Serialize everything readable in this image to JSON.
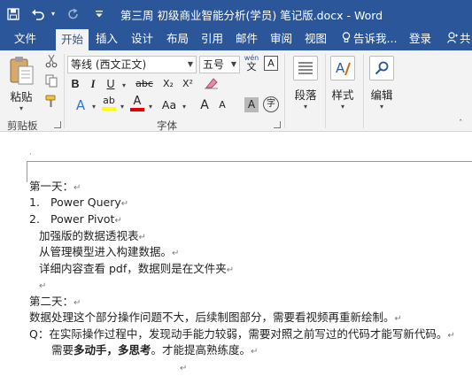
{
  "window": {
    "title": "第三周 初级商业智能分析(学员) 笔记版.docx - Word"
  },
  "quick_access": {
    "save_icon": "save-icon",
    "undo_icon": "undo-icon",
    "redo_icon": "redo-icon",
    "customize_icon": "customize-icon"
  },
  "tabs": {
    "file": "文件",
    "home": "开始",
    "insert": "插入",
    "design": "设计",
    "layout": "布局",
    "references": "引用",
    "mailings": "邮件",
    "review": "审阅",
    "view": "视图",
    "tell_me": "告诉我...",
    "login": "登录",
    "share": "共"
  },
  "ribbon": {
    "clipboard": {
      "paste_label": "粘贴",
      "group_label": "剪贴板"
    },
    "font": {
      "font_name": "等线 (西文正文)",
      "font_size": "五号",
      "wen_glyph": "wén",
      "wen_char": "文",
      "boxed_a": "A",
      "bold": "B",
      "italic": "I",
      "underline": "U",
      "strike": "abc",
      "subscript": "X₂",
      "superscript": "X²",
      "highlight": "ab",
      "font_color": "A",
      "change_case": "Aa",
      "grow": "A",
      "shrink": "A",
      "shading": "A",
      "enclose": "字",
      "group_label": "字体"
    },
    "paragraph": {
      "label": "段落"
    },
    "styles": {
      "label": "样式"
    },
    "editing": {
      "label": "编辑"
    }
  },
  "document": {
    "header_mark": "·",
    "lines": {
      "day1": "第一天：",
      "item1_num": "1.",
      "item1": "Power Query",
      "item2_num": "2.",
      "item2": "Power Pivot",
      "line_a": "加强版的数据透视表",
      "line_b": "从管理模型进入构建数据。",
      "line_c": "详细内容查看 pdf，数据则是在文件夹",
      "day2": "第二天：",
      "line_d": "数据处理这个部分操作问题不大，后续制图部分，需要看视频再重新绘制。",
      "line_e": "Q：在实际操作过程中，发现动手能力较弱，需要对照之前写过的代码才能写新代码。",
      "line_f_prefix": "需要",
      "line_f_bold": "多动手，多思考",
      "line_f_suffix": "。才能提高熟练度。"
    },
    "para_mark": "↵"
  },
  "colors": {
    "title_bar": "#2b579a",
    "ribbon_bg": "#f3f3f3",
    "highlight_yellow": "#ffff00",
    "font_red": "#e00000"
  }
}
